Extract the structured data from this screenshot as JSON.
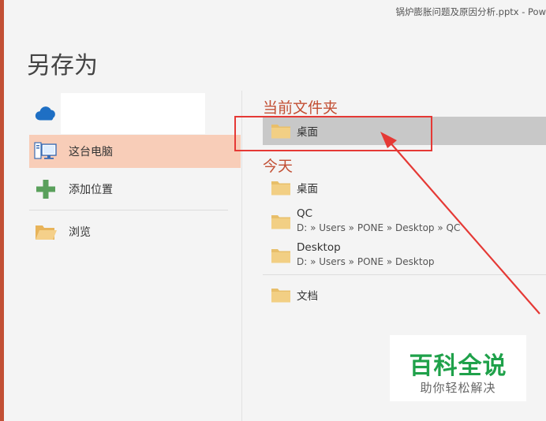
{
  "window": {
    "title": "锅炉膨胀问题及原因分析.pptx - Pow"
  },
  "page": {
    "title": "另存为"
  },
  "left_panel": {
    "items": [
      {
        "label": "",
        "icon": "onedrive-cloud-icon"
      },
      {
        "label": "这台电脑",
        "icon": "computer-icon",
        "selected": true
      },
      {
        "label": "添加位置",
        "icon": "plus-icon"
      },
      {
        "label": "浏览",
        "icon": "open-folder-icon"
      }
    ]
  },
  "current_folder": {
    "title": "当前文件夹",
    "items": [
      {
        "name": "桌面"
      }
    ]
  },
  "today": {
    "title": "今天",
    "items": [
      {
        "name": "桌面",
        "path": ""
      },
      {
        "name": "QC",
        "path": "D: » Users » PONE » Desktop » QC"
      },
      {
        "name": "Desktop",
        "path": "D: » Users » PONE » Desktop"
      }
    ]
  },
  "older": {
    "items": [
      {
        "name": "文档"
      }
    ]
  },
  "watermark": {
    "title": "百科全说",
    "subtitle": "助你轻松解决"
  },
  "colors": {
    "accent": "#c24f34",
    "selected_bg": "#f8cdb8",
    "current_row_bg": "#c8c8c8",
    "annotation_red": "#e53935",
    "folder": "#f0c878",
    "watermark_green": "#1fa14a"
  }
}
